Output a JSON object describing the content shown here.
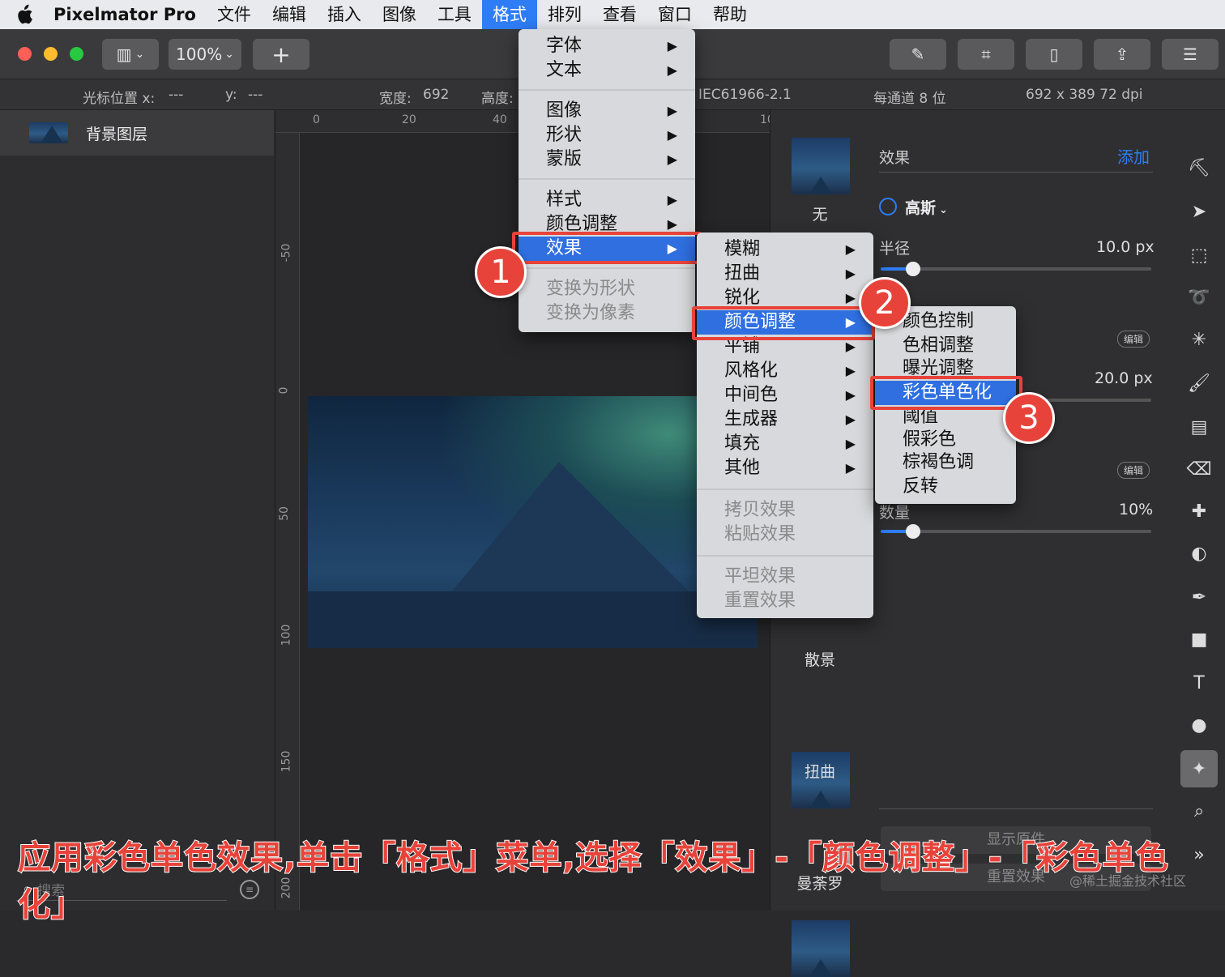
{
  "menubar": {
    "app_name": "Pixelmator Pro",
    "items": [
      "文件",
      "编辑",
      "插入",
      "图像",
      "工具",
      "格式",
      "排列",
      "查看",
      "窗口",
      "帮助"
    ],
    "active_item": "格式"
  },
  "toolbar": {
    "zoom": "100%",
    "add": "+"
  },
  "infobar": {
    "cursor_x_label": "光标位置 x:",
    "cursor_x": "---",
    "cursor_y_label": "y:",
    "cursor_y": "---",
    "width_label": "宽度:",
    "width": "692",
    "height_label": "高度:",
    "profile": "IEC61966-2.1",
    "depth": "每通道 8 位",
    "size": "692 x 389 72 dpi"
  },
  "layers": {
    "layer_name": "背景图层",
    "search_placeholder": "搜索"
  },
  "rulers": {
    "h": [
      "0",
      "20",
      "40",
      "10"
    ],
    "v": [
      "-50",
      "0",
      "50",
      "100",
      "150",
      "200"
    ]
  },
  "format_menu": {
    "items": [
      "字体",
      "文本",
      "图像",
      "形状",
      "蒙版",
      "样式",
      "颜色调整",
      "效果",
      "变换为形状",
      "变换为像素"
    ]
  },
  "effects_menu": {
    "items": [
      "模糊",
      "扭曲",
      "锐化",
      "颜色调整",
      "平铺",
      "风格化",
      "中间色",
      "生成器",
      "填充",
      "其他",
      "拷贝效果",
      "粘贴效果",
      "平坦效果",
      "重置效果"
    ]
  },
  "color_menu": {
    "items": [
      "颜色控制",
      "色相调整",
      "曝光调整",
      "彩色单色化",
      "阈值",
      "假彩色",
      "棕褐色调",
      "反转"
    ]
  },
  "right_panel": {
    "section_title": "效果",
    "add": "添加",
    "effect_name": "高斯",
    "radius_label": "半径",
    "radius_value": "10.0 px",
    "second_value": "20.0 px",
    "edit1": "编辑",
    "edit2": "编辑",
    "amount_label": "数量",
    "amount_value": "10%",
    "radius_pct": 0.12,
    "amount_pct": 0.12,
    "presets": [
      "无",
      "散景",
      "扭曲",
      "曼荼罗"
    ],
    "bottom_btn1": "显示原件",
    "bottom_btn2": "重置效果"
  },
  "steps": [
    "1",
    "2",
    "3"
  ],
  "caption": "应用彩色单色效果,单击「格式」菜单,选择「效果」-「颜色调整」-「彩色单色化」",
  "watermark": "@稀土掘金技术社区",
  "colors": {
    "accent": "#2f7df6",
    "annotation": "#e8433a"
  }
}
